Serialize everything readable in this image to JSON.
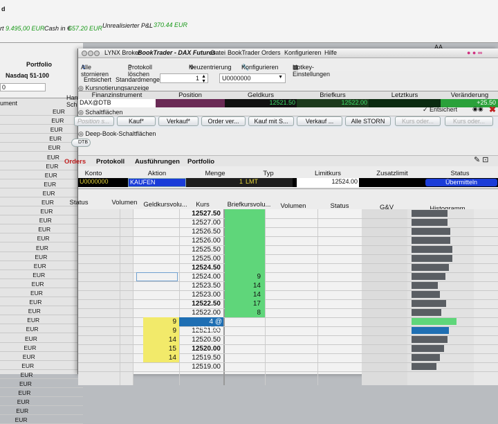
{
  "topbar": {
    "left_fragment": "d",
    "cash_prefix": "rt",
    "cash_prefix_value": "9.495,00 EUR",
    "cash_label": "Cash in €",
    "cash_value": "657.20 EUR",
    "pnl_label": "Unrealisierter P&L",
    "pnl_value": "370.44 EUR",
    "portfolio": "Portfolio",
    "nasdaq": "Nasdaq 51-100",
    "dropdown_value": "0",
    "hand_label": "Hand",
    "schl_label": "Schlü",
    "instrument_label": "ument",
    "aa": "AA"
  },
  "background_list": {
    "currency": "EUR",
    "rows": 35
  },
  "titlebar": {
    "app": "LYNX Broker",
    "window": "BookTrader - DAX Futures",
    "menus": [
      "Datei",
      "BookTrader",
      "Orders",
      "Konfigurieren",
      "Hilfe"
    ]
  },
  "toolbar": {
    "cancel_all": "Alle stornieren",
    "delete_log": "Protokoll löschen",
    "recenter": "Neuzentrierung",
    "configure": "Konfigurieren",
    "hotkey": "Hotkey-Einstellungen"
  },
  "settings": {
    "unlocked": "Entsichert",
    "default_qty_label": "Standardmenge",
    "default_qty": "1",
    "account": "U0000000"
  },
  "quote": {
    "section": "Kursnotierungsanzeige",
    "headers": [
      "Finanzinstrument",
      "Position",
      "Geldkurs",
      "Briefkurs",
      "Letztkurs",
      "Veränderung"
    ],
    "instrument": "DAX@DTB",
    "position": "",
    "bid": "12521.50",
    "ask": "12522.00",
    "last": "",
    "change": "+25.50"
  },
  "buttons": {
    "section": "Schaltflächen",
    "locked": "Entsichert",
    "items": [
      "Kauf*",
      "Verkauf*",
      "Order ver...",
      "Kauf mit S...",
      "Verkauf ...",
      "Alle STORN",
      "Kurs oder...",
      "Kurs oder..."
    ],
    "position_placeholder": "Position s..."
  },
  "deep_book": {
    "section": "Deep-Book-Schaltflächen",
    "tag": "DTB"
  },
  "tabs": [
    "Orders",
    "Protokoll",
    "Ausführungen",
    "Portfolio"
  ],
  "orders": {
    "headers": [
      "Konto",
      "Aktion",
      "Menge",
      "Typ",
      "Limitkurs",
      "Zusatzlimit",
      "Status"
    ],
    "row": {
      "account": "U0000000",
      "action": "KAUFEN",
      "qty": "1",
      "type": "LMT",
      "limit": "12524.00",
      "extra": "",
      "status": "Übermitteln"
    }
  },
  "book": {
    "headers": [
      "Status",
      "Volumen",
      "Geldkursvolu...",
      "Kurs",
      "Briefkursvolu...",
      "Volumen",
      "Status",
      "G&V",
      "Histogramm"
    ],
    "prices": [
      "12527.50",
      "12527.00",
      "12526.50",
      "12526.00",
      "12525.50",
      "12525.00",
      "12524.50",
      "12524.00",
      "12523.50",
      "12523.00",
      "12522.50",
      "12522.00",
      "12521.50",
      "12521.00",
      "12520.50",
      "12520.00",
      "12519.50",
      "12519.00"
    ],
    "ask_volumes": [
      "",
      "",
      "",
      "",
      "",
      "",
      "",
      "9",
      "14",
      "14",
      "17",
      "8",
      "",
      "",
      "",
      "",
      "",
      ""
    ],
    "bid_volumes": [
      "",
      "",
      "",
      "",
      "",
      "",
      "",
      "",
      "",
      "",
      "",
      "",
      "9",
      "9",
      "14",
      "15",
      "14",
      ""
    ],
    "current_bid_label": "4 @ 12521.50",
    "histogram": [
      0.58,
      0.58,
      0.62,
      0.62,
      0.66,
      0.66,
      0.6,
      0.54,
      0.42,
      0.45,
      0.56,
      0.48,
      0.72,
      0.6,
      0.58,
      0.52,
      0.45,
      0.4
    ]
  },
  "colors": {
    "ask_green": "#5fd67a",
    "bid_yellow": "#f2ea6a",
    "highlight_blue": "#1f6fb3",
    "histogram": "#5a5e63"
  }
}
